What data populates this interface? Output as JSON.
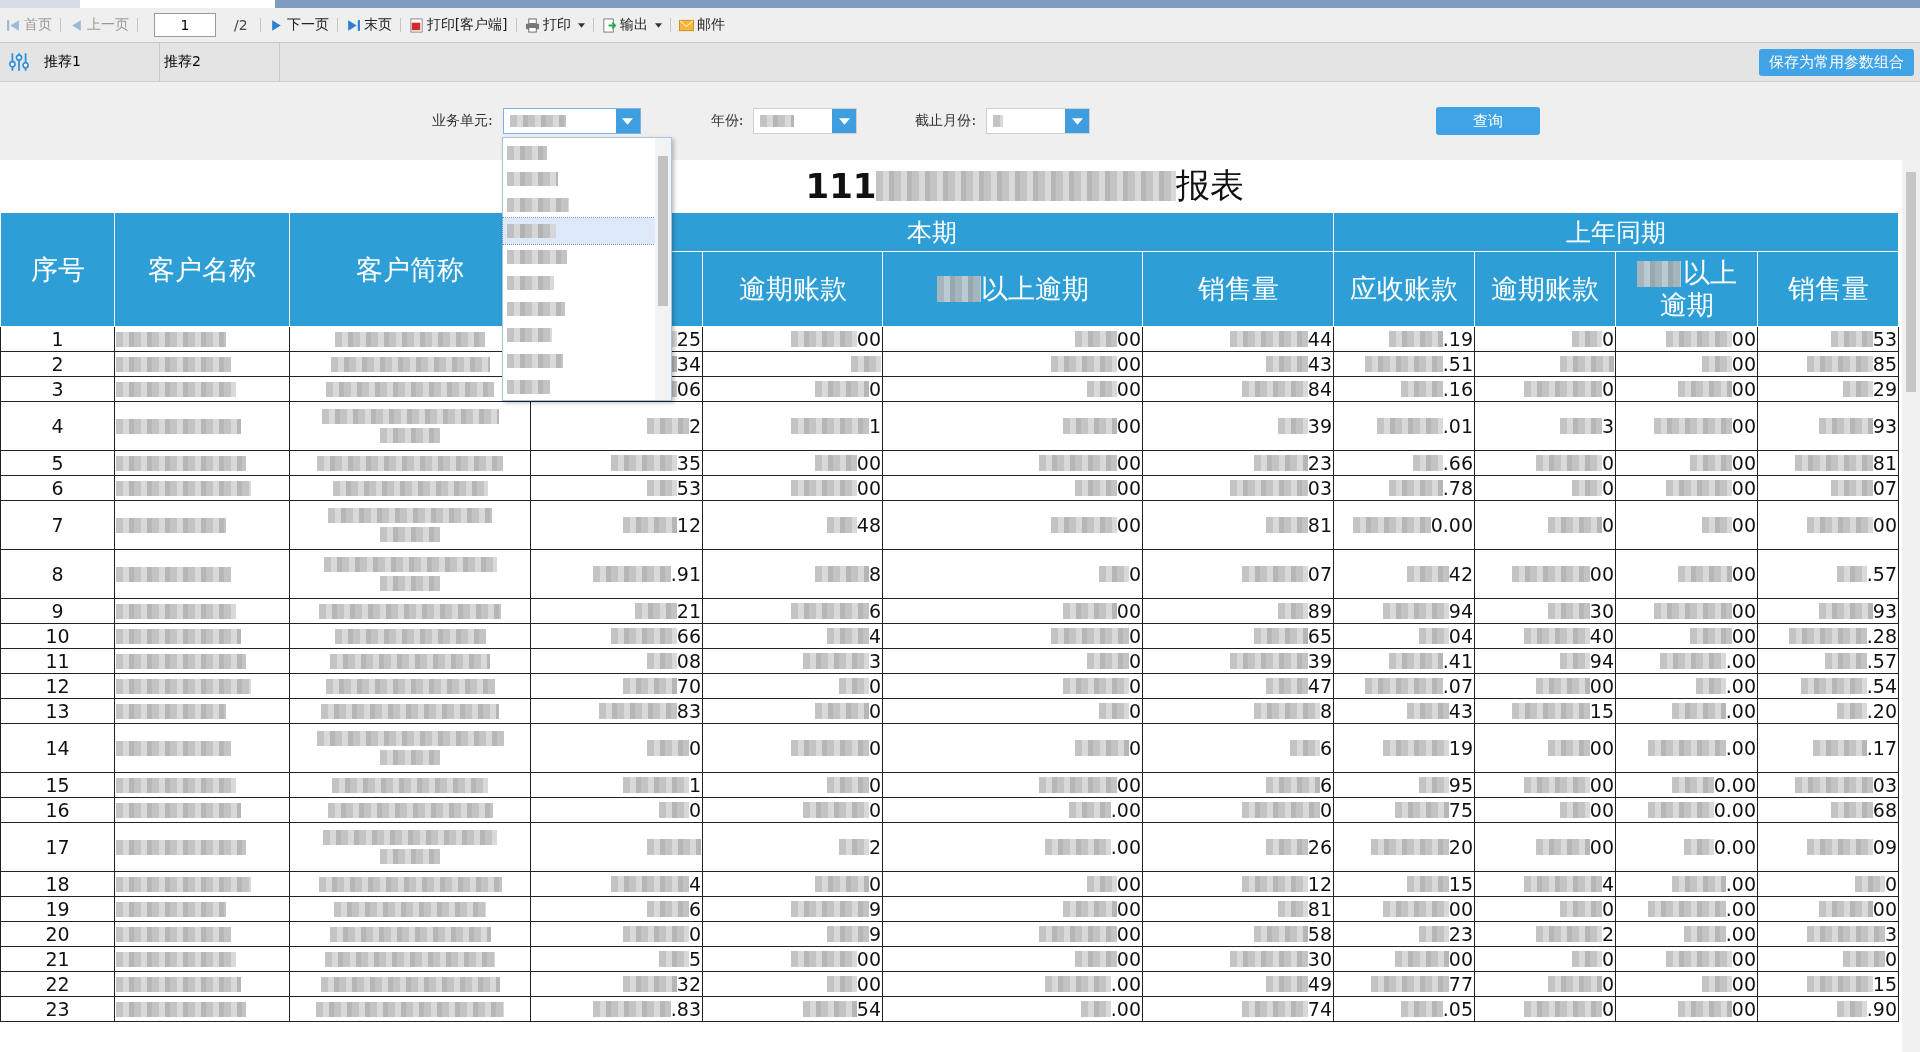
{
  "toolbar": {
    "items": [
      {
        "kind": "first",
        "label": "首页",
        "disabled": true
      },
      {
        "kind": "prev",
        "label": "上一页",
        "disabled": true
      },
      {
        "kind": "page",
        "value": "1",
        "total": "/2"
      },
      {
        "kind": "next",
        "label": "下一页",
        "disabled": false
      },
      {
        "kind": "last",
        "label": "末页",
        "disabled": false
      },
      {
        "kind": "printclient",
        "label": "打印[客户端]",
        "disabled": false
      },
      {
        "kind": "print",
        "label": "打印",
        "disabled": false
      },
      {
        "kind": "export",
        "label": "输出",
        "disabled": false
      },
      {
        "kind": "mail",
        "label": "邮件",
        "disabled": false
      }
    ]
  },
  "presets": {
    "tabs": [
      {
        "label": "推荐1",
        "selected": false
      },
      {
        "label": "推荐2",
        "selected": false
      }
    ],
    "save_button": "保存为常用参数组合"
  },
  "filters": {
    "fields": [
      {
        "label": "业务单元:",
        "open": true
      },
      {
        "label": "年份:",
        "open": false
      },
      {
        "label": "截止月份:",
        "open": false
      }
    ],
    "query_button": "查询",
    "dropdown_items": [
      {
        "selected": false
      },
      {
        "selected": false
      },
      {
        "selected": false
      },
      {
        "selected": true
      },
      {
        "selected": false
      },
      {
        "selected": false
      },
      {
        "selected": false
      },
      {
        "selected": false
      },
      {
        "selected": false
      },
      {
        "selected": false
      }
    ]
  },
  "report": {
    "title_parts": [
      "111",
      "报表"
    ],
    "fixed_columns": [
      {
        "label": "序号"
      },
      {
        "label": "客户名称"
      },
      {
        "label": "客户简称"
      }
    ],
    "groups": [
      {
        "label": "本期"
      },
      {
        "label": "上年同期"
      }
    ],
    "columns": [
      {
        "masked": false
      },
      {
        "label": "逾期账款",
        "masked": false
      },
      {
        "label": "以上逾期",
        "masked": true
      },
      {
        "label": "销售量",
        "masked": false
      },
      {
        "label": "应收账款",
        "masked": false
      },
      {
        "label": "逾期账款",
        "masked": false
      },
      {
        "label": "以上逾期",
        "masked": true
      },
      {
        "label": "销售量",
        "masked": false
      }
    ],
    "rows": [
      {
        "no": "1",
        "tall": false,
        "cells": [
          "25",
          "00",
          "00",
          "44",
          ".19",
          "0",
          "00",
          "53"
        ]
      },
      {
        "no": "2",
        "tall": false,
        "cells": [
          "34",
          null,
          "00",
          "43",
          ".51",
          null,
          "00",
          "85"
        ]
      },
      {
        "no": "3",
        "tall": false,
        "cells": [
          "06",
          "0",
          "00",
          "84",
          ".16",
          "0",
          "00",
          "29"
        ]
      },
      {
        "no": "4",
        "tall": true,
        "cells": [
          "2",
          "1",
          "00",
          "39",
          ".01",
          "3",
          "00",
          "93"
        ]
      },
      {
        "no": "5",
        "tall": false,
        "cells": [
          "35",
          "00",
          "00",
          "23",
          ".66",
          "0",
          "00",
          "81"
        ]
      },
      {
        "no": "6",
        "tall": false,
        "cells": [
          "53",
          "00",
          "00",
          "03",
          ".78",
          "0",
          "00",
          "07"
        ]
      },
      {
        "no": "7",
        "tall": true,
        "cells": [
          "12",
          "48",
          "00",
          "81",
          "0.00",
          "0",
          "00",
          "00"
        ]
      },
      {
        "no": "8",
        "tall": true,
        "cells": [
          ".91",
          "8",
          "0",
          "07",
          "42",
          "00",
          "00",
          ".57"
        ]
      },
      {
        "no": "9",
        "tall": false,
        "cells": [
          "21",
          "6",
          "00",
          "89",
          "94",
          "30",
          "00",
          "93"
        ]
      },
      {
        "no": "10",
        "tall": false,
        "cells": [
          "66",
          "4",
          "0",
          "65",
          "04",
          "40",
          "00",
          ".28"
        ]
      },
      {
        "no": "11",
        "tall": false,
        "cells": [
          "08",
          "3",
          "0",
          "39",
          ".41",
          "94",
          ".00",
          ".57"
        ]
      },
      {
        "no": "12",
        "tall": false,
        "cells": [
          "70",
          "0",
          "0",
          "47",
          ".07",
          "00",
          ".00",
          ".54"
        ]
      },
      {
        "no": "13",
        "tall": false,
        "cells": [
          "83",
          "0",
          "0",
          "8",
          "43",
          "15",
          ".00",
          ".20"
        ]
      },
      {
        "no": "14",
        "tall": true,
        "cells": [
          "0",
          "0",
          "0",
          "6",
          "19",
          "00",
          ".00",
          ".17"
        ]
      },
      {
        "no": "15",
        "tall": false,
        "cells": [
          "1",
          "0",
          "00",
          "6",
          "95",
          "00",
          "0.00",
          "03"
        ]
      },
      {
        "no": "16",
        "tall": false,
        "cells": [
          "0",
          "0",
          ".00",
          "0",
          "75",
          "00",
          "0.00",
          "68"
        ]
      },
      {
        "no": "17",
        "tall": true,
        "cells": [
          null,
          "2",
          ".00",
          "26",
          "20",
          "00",
          "0.00",
          "09"
        ]
      },
      {
        "no": "18",
        "tall": false,
        "cells": [
          "4",
          "0",
          "00",
          "12",
          "15",
          "4",
          ".00",
          "0"
        ]
      },
      {
        "no": "19",
        "tall": false,
        "cells": [
          "6",
          "9",
          "00",
          "81",
          "00",
          "0",
          ".00",
          "00"
        ]
      },
      {
        "no": "20",
        "tall": false,
        "cells": [
          "0",
          "9",
          "00",
          "58",
          "23",
          "2",
          ".00",
          "3"
        ]
      },
      {
        "no": "21",
        "tall": false,
        "cells": [
          "5",
          "00",
          "00",
          "30",
          "00",
          "0",
          "00",
          "0"
        ]
      },
      {
        "no": "22",
        "tall": false,
        "cells": [
          "32",
          "00",
          ".00",
          "49",
          "77",
          "0",
          "00",
          "15"
        ]
      },
      {
        "no": "23",
        "tall": false,
        "cells": [
          ".83",
          "54",
          ".00",
          "74",
          ".05",
          "0",
          "00",
          ".90"
        ]
      }
    ]
  }
}
